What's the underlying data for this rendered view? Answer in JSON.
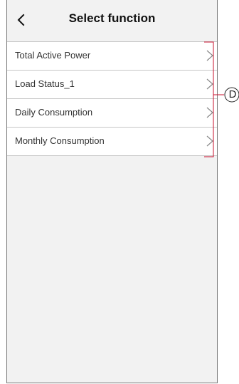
{
  "header": {
    "title": "Select function",
    "back_icon": "chevron-left-icon"
  },
  "functions": [
    {
      "label": "Total Active Power",
      "icon": "chevron-right-icon"
    },
    {
      "label": "Load Status_1",
      "icon": "chevron-right-icon"
    },
    {
      "label": "Daily Consumption",
      "icon": "chevron-right-icon"
    },
    {
      "label": "Monthly Consumption",
      "icon": "chevron-right-icon"
    }
  ],
  "callout": {
    "letter": "D",
    "color": "#c8102e"
  },
  "colors": {
    "background": "#f2f2f2",
    "list_background": "#ffffff",
    "divider": "#c6c6c6",
    "chevron": "#888888"
  }
}
